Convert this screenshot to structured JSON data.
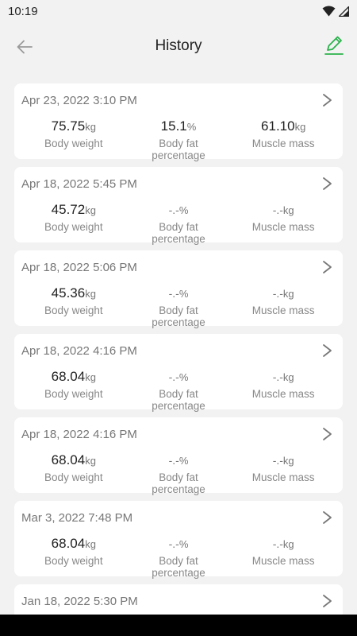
{
  "status": {
    "time": "10:19"
  },
  "header": {
    "title": "History"
  },
  "records": [
    {
      "date": "Apr 23, 2022 3:10 PM",
      "weight": {
        "value": "75.75",
        "unit": "kg",
        "label": "Body weight"
      },
      "fat": {
        "value": "15.1",
        "unit": "%",
        "label": "Body fat percentage"
      },
      "muscle": {
        "value": "61.10",
        "unit": "kg",
        "label": "Muscle mass"
      }
    },
    {
      "date": "Apr 18, 2022 5:45 PM",
      "weight": {
        "value": "45.72",
        "unit": "kg",
        "label": "Body weight"
      },
      "fat": {
        "value": "-.-",
        "unit": "%",
        "label": "Body fat percentage"
      },
      "muscle": {
        "value": "-.-",
        "unit": "kg",
        "label": "Muscle mass"
      }
    },
    {
      "date": "Apr 18, 2022 5:06 PM",
      "weight": {
        "value": "45.36",
        "unit": "kg",
        "label": "Body weight"
      },
      "fat": {
        "value": "-.-",
        "unit": "%",
        "label": "Body fat percentage"
      },
      "muscle": {
        "value": "-.-",
        "unit": "kg",
        "label": "Muscle mass"
      }
    },
    {
      "date": "Apr 18, 2022 4:16 PM",
      "weight": {
        "value": "68.04",
        "unit": "kg",
        "label": "Body weight"
      },
      "fat": {
        "value": "-.-",
        "unit": "%",
        "label": "Body fat percentage"
      },
      "muscle": {
        "value": "-.-",
        "unit": "kg",
        "label": "Muscle mass"
      }
    },
    {
      "date": "Apr 18, 2022 4:16 PM",
      "weight": {
        "value": "68.04",
        "unit": "kg",
        "label": "Body weight"
      },
      "fat": {
        "value": "-.-",
        "unit": "%",
        "label": "Body fat percentage"
      },
      "muscle": {
        "value": "-.-",
        "unit": "kg",
        "label": "Muscle mass"
      }
    },
    {
      "date": "Mar 3, 2022 7:48 PM",
      "weight": {
        "value": "68.04",
        "unit": "kg",
        "label": "Body weight"
      },
      "fat": {
        "value": "-.-",
        "unit": "%",
        "label": "Body fat percentage"
      },
      "muscle": {
        "value": "-.-",
        "unit": "kg",
        "label": "Muscle mass"
      }
    },
    {
      "date": "Jan 18, 2022 5:30 PM",
      "weight": {
        "value": "",
        "unit": "",
        "label": ""
      },
      "fat": {
        "value": "",
        "unit": "",
        "label": ""
      },
      "muscle": {
        "value": "",
        "unit": "",
        "label": ""
      }
    }
  ],
  "icons": {
    "back": "back-arrow-icon",
    "edit": "pencil-edit-icon",
    "chevron": "chevron-right-icon"
  },
  "colors": {
    "accent": "#2bb24c",
    "background": "#f2f2f2",
    "card": "#ffffff",
    "muted": "#888888"
  }
}
